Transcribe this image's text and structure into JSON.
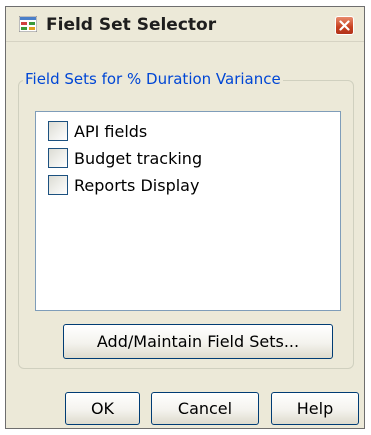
{
  "window": {
    "title": "Field Set Selector",
    "icon": "field-set-app-icon",
    "close_icon": "close-icon"
  },
  "group": {
    "label": "Field Sets for % Duration Variance"
  },
  "field_sets": [
    {
      "label": "API fields",
      "checked": false
    },
    {
      "label": "Budget tracking",
      "checked": false
    },
    {
      "label": "Reports Display",
      "checked": false
    }
  ],
  "buttons": {
    "add_maintain": "Add/Maintain Field Sets...",
    "ok": "OK",
    "cancel": "Cancel",
    "help": "Help"
  },
  "colors": {
    "dialog_bg": "#ece9d8",
    "group_label": "#0046d5",
    "close_button": "#c7401f",
    "button_border": "#003c74"
  }
}
